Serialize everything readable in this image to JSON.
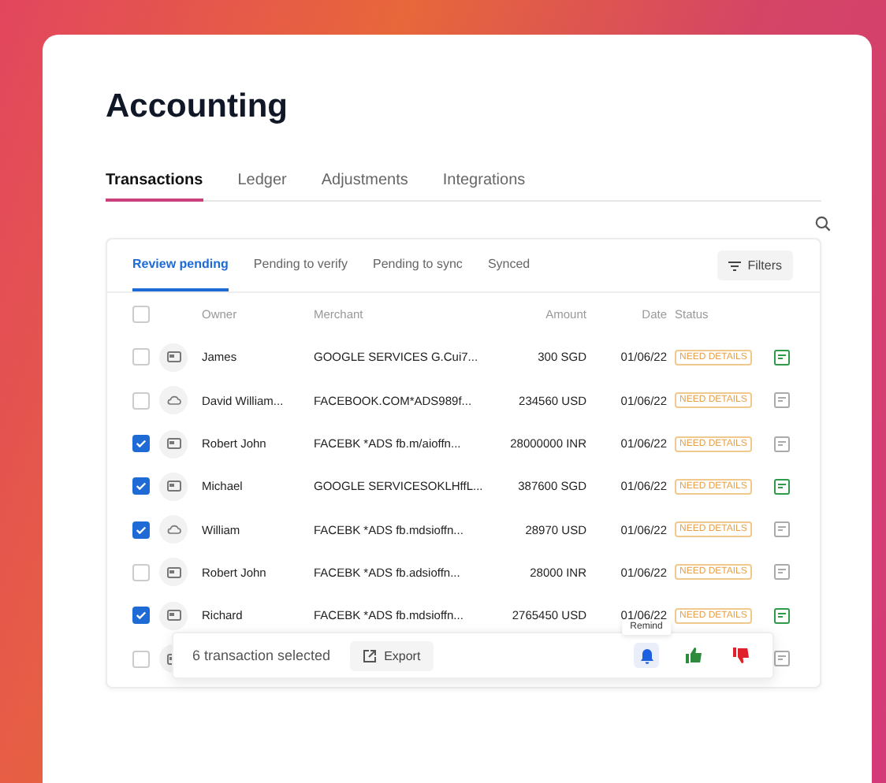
{
  "page": {
    "title": "Accounting"
  },
  "tabs": [
    {
      "label": "Transactions",
      "selected": true
    },
    {
      "label": "Ledger",
      "selected": false
    },
    {
      "label": "Adjustments",
      "selected": false
    },
    {
      "label": "Integrations",
      "selected": false
    }
  ],
  "table": {
    "subtabs": [
      {
        "label": "Review pending",
        "selected": true
      },
      {
        "label": "Pending to verify",
        "selected": false
      },
      {
        "label": "Pending to sync",
        "selected": false
      },
      {
        "label": "Synced",
        "selected": false
      }
    ],
    "filters_button": "Filters",
    "all_checked": false,
    "columns": [
      "Owner",
      "Merchant",
      "Amount",
      "Date",
      "Status"
    ],
    "rows": [
      {
        "kind": "card",
        "checked": false,
        "owner": "James",
        "merchant": "GOOGLE SERVICES G.Cui7...",
        "amount": "300 SGD",
        "date": "01/06/22",
        "status": "NEED DETAILS",
        "note_done": true
      },
      {
        "kind": "cloud",
        "checked": false,
        "owner": "David William...",
        "merchant": "FACEBOOK.COM*ADS989f...",
        "amount": "234560 USD",
        "date": "01/06/22",
        "status": "NEED DETAILS",
        "note_done": false
      },
      {
        "kind": "card",
        "checked": true,
        "owner": "Robert John",
        "merchant": "FACEBK *ADS fb.m/aioffn...",
        "amount": "28000000 INR",
        "date": "01/06/22",
        "status": "NEED DETAILS",
        "note_done": false
      },
      {
        "kind": "card",
        "checked": true,
        "owner": "Michael",
        "merchant": "GOOGLE SERVICESOKLHffL...",
        "amount": "387600 SGD",
        "date": "01/06/22",
        "status": "NEED DETAILS",
        "note_done": true
      },
      {
        "kind": "cloud",
        "checked": true,
        "owner": "William",
        "merchant": "FACEBK *ADS fb.mdsioffn...",
        "amount": "28970 USD",
        "date": "01/06/22",
        "status": "NEED DETAILS",
        "note_done": false
      },
      {
        "kind": "card",
        "checked": false,
        "owner": "Robert John",
        "merchant": "FACEBK *ADS fb.adsioffn...",
        "amount": "28000 INR",
        "date": "01/06/22",
        "status": "NEED DETAILS",
        "note_done": false
      },
      {
        "kind": "card",
        "checked": true,
        "owner": "Richard",
        "merchant": "FACEBK *ADS fb.mdsioffn...",
        "amount": "2765450 USD",
        "date": "01/06/22",
        "status": "NEED DETAILS",
        "note_done": true
      },
      {
        "kind": "card",
        "checked": false,
        "note_done": false
      }
    ]
  },
  "action_bar": {
    "summary": "6 transaction selected",
    "export_button": "Export",
    "tooltip": "Remind"
  }
}
